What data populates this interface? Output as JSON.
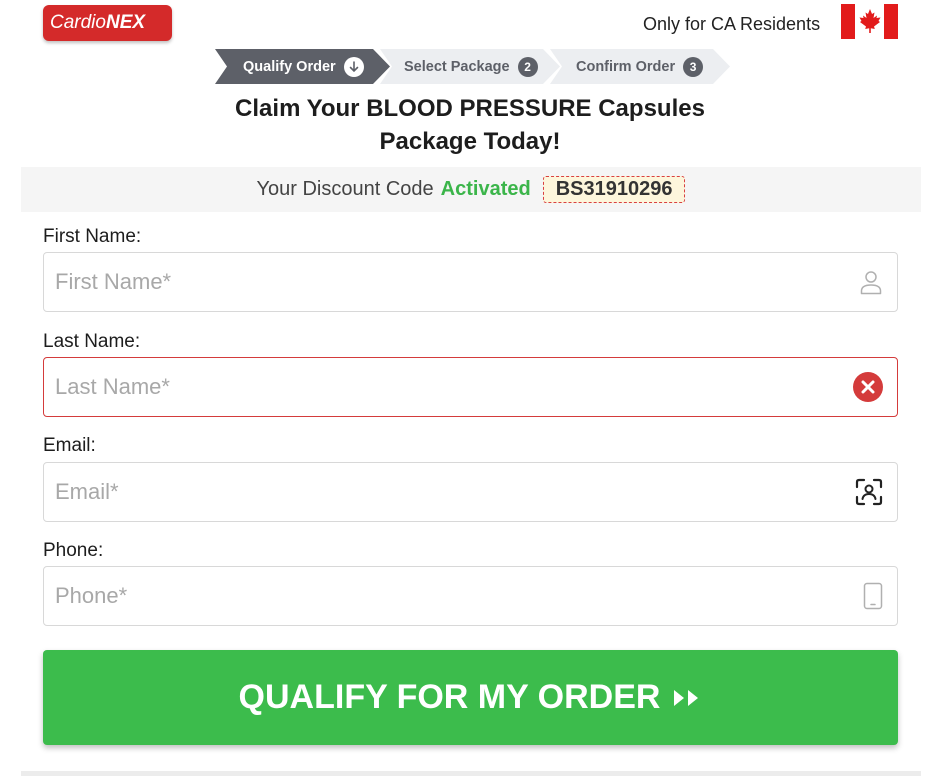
{
  "brand": {
    "part1": "Cardio",
    "part2": "NEX"
  },
  "header": {
    "residents": "Only for CA Residents"
  },
  "steps": [
    {
      "label": "Qualify Order",
      "active": true
    },
    {
      "label": "Select Package",
      "num": "2",
      "active": false
    },
    {
      "label": "Confirm Order",
      "num": "3",
      "active": false
    }
  ],
  "headline": {
    "line1": "Claim Your BLOOD PRESSURE Capsules",
    "line2": "Package Today!"
  },
  "discount": {
    "prefix": "Your Discount Code",
    "status": "Activated",
    "code": "BS31910296"
  },
  "form": {
    "first_name": {
      "label": "First Name:",
      "placeholder": "First Name*",
      "value": ""
    },
    "last_name": {
      "label": "Last Name:",
      "placeholder": "Last Name*",
      "value": "",
      "error": true
    },
    "email": {
      "label": "Email:",
      "placeholder": "Email*",
      "value": ""
    },
    "phone": {
      "label": "Phone:",
      "placeholder": "Phone*",
      "value": ""
    }
  },
  "submit": {
    "label": "QUALIFY FOR MY ORDER"
  },
  "colors": {
    "brand_red": "#d42a2a",
    "accent_green": "#3cbc4c",
    "step_dark": "#5d6068",
    "error_red": "#d43b3b"
  },
  "icons": [
    "user-icon",
    "error-x-icon",
    "contact-scan-icon",
    "phone-device-icon",
    "maple-leaf-icon",
    "down-arrow-icon",
    "double-chevron-icon"
  ]
}
